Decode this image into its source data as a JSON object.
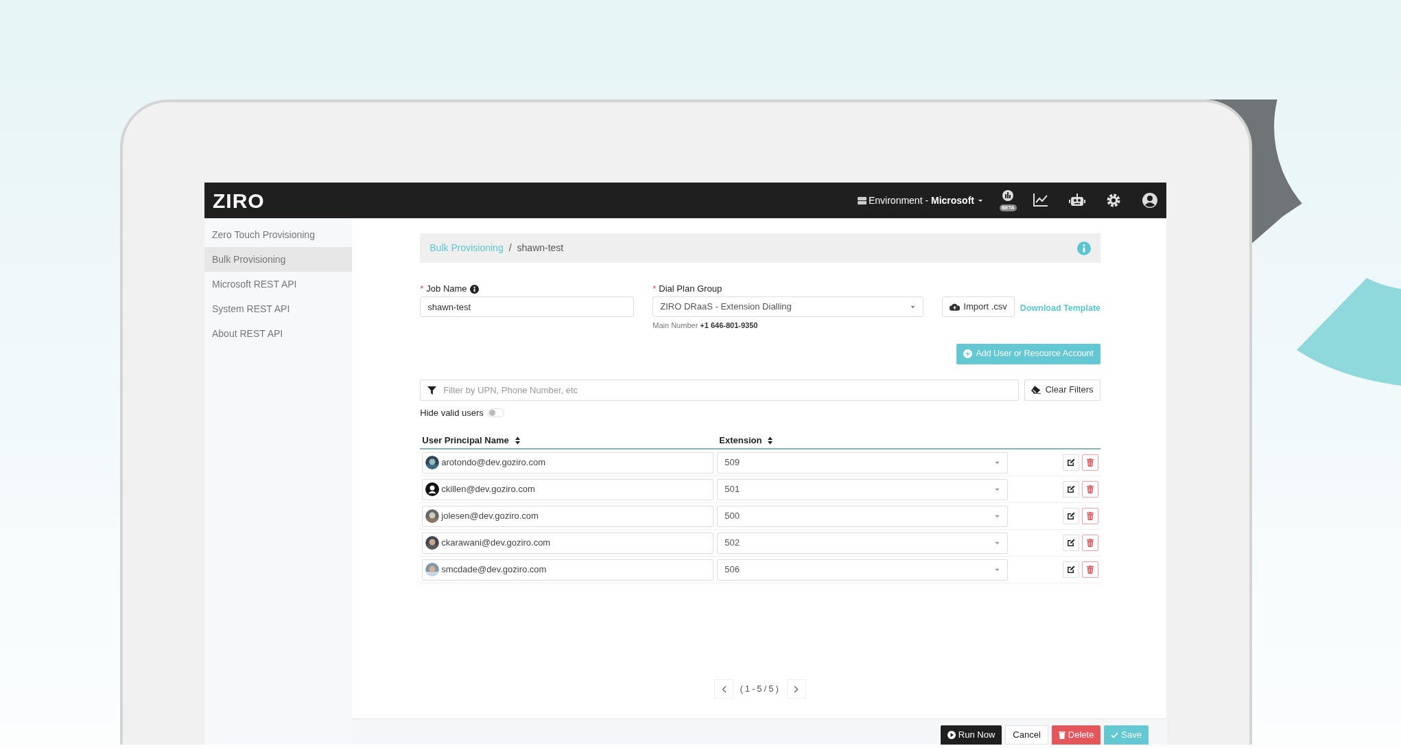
{
  "topbar": {
    "logo": "ZIRO",
    "environment": "Environment - **Microsoft**",
    "beta_badge": "BETA"
  },
  "sidebar": {
    "items": [
      {
        "label": "Zero Touch Provisioning",
        "selected": false
      },
      {
        "label": "Bulk Provisioning",
        "selected": true
      },
      {
        "label": "Microsoft REST API",
        "selected": false
      },
      {
        "label": "System REST API",
        "selected": false
      },
      {
        "label": "About REST API",
        "selected": false
      }
    ]
  },
  "breadcrumb": {
    "items": [
      "Bulk Provisioning",
      "shawn-test"
    ],
    "separator": "/"
  },
  "form": {
    "required_mark": "*",
    "job_name": {
      "label": "Job Name",
      "required": true,
      "value": "shawn-test"
    },
    "dial_plan_group": {
      "label": "Dial Plan Group",
      "required": true,
      "value": "ZIRO DRaaS - Extension Dialling",
      "hint_label": "Main Number",
      "hint_value": "+1 646-801-9350"
    },
    "import_button": "Import .csv",
    "download_link": "Download Template"
  },
  "add_button": "Add User or Resource Account",
  "filter": {
    "placeholder": "Filter by UPN, Phone Number, etc",
    "clear_button": "Clear Filters"
  },
  "hide_valid_users": {
    "label": "Hide valid users",
    "on": false
  },
  "table": {
    "columns": [
      {
        "label": "User Principal Name",
        "sortable": true
      },
      {
        "label": "Extension",
        "sortable": true
      }
    ],
    "rows": [
      {
        "upn": "arotondo@dev.goziro.com",
        "extension": "509"
      },
      {
        "upn": "ckillen@dev.goziro.com",
        "extension": "501",
        "kind": "default"
      },
      {
        "upn": "jolesen@dev.goziro.com",
        "extension": "500"
      },
      {
        "upn": "ckarawani@dev.goziro.com",
        "extension": "502"
      },
      {
        "upn": "smcdade@dev.goziro.com",
        "extension": "506"
      }
    ]
  },
  "pagination": {
    "range": "(1-5/5)"
  },
  "footer_buttons": [
    {
      "label": "Run Now",
      "kind": "run"
    },
    {
      "label": "Cancel",
      "kind": "cancel"
    },
    {
      "label": "Delete",
      "kind": "delete"
    },
    {
      "label": "Save",
      "kind": "save"
    }
  ]
}
